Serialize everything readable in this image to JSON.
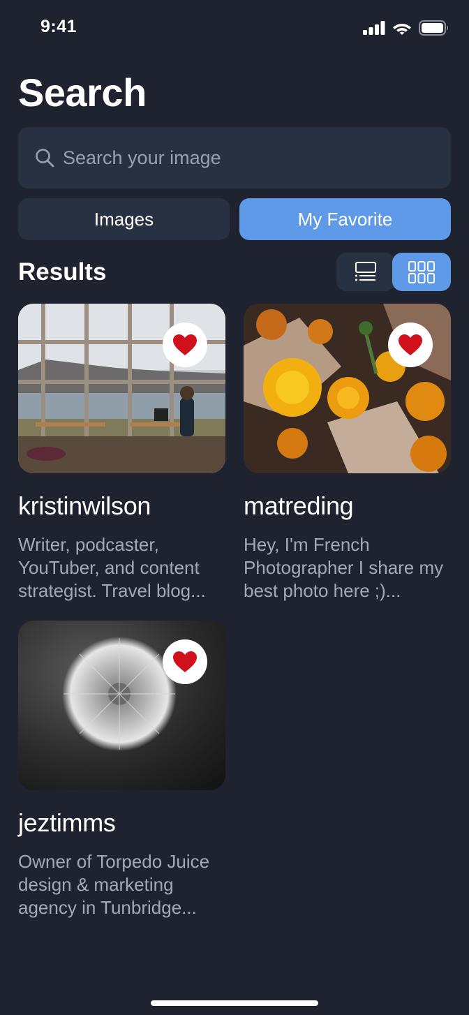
{
  "status_bar": {
    "time": "9:41"
  },
  "header": {
    "title": "Search"
  },
  "search": {
    "placeholder": "Search your image",
    "value": ""
  },
  "tabs": [
    {
      "label": "Images",
      "active": false
    },
    {
      "label": "My Favorite",
      "active": true
    }
  ],
  "results": {
    "title": "Results",
    "view_mode": "grid",
    "items": [
      {
        "username": "kristinwilson",
        "bio": "Writer, podcaster, YouTuber, and content strategist. Travel blog...",
        "favorited": true,
        "image_icon": "office-window-photo"
      },
      {
        "username": "matreding",
        "bio": "Hey,  I'm French Photographer I share my best photo here ;)...",
        "favorited": true,
        "image_icon": "flowers-photo"
      },
      {
        "username": "jeztimms",
        "bio": "Owner of Torpedo Juice design & marketing agency in Tunbridge...",
        "favorited": true,
        "image_icon": "dandelion-photo"
      }
    ]
  },
  "colors": {
    "background": "#1f2330",
    "surface": "#283142",
    "accent": "#5e9ae8",
    "heart": "#d0101b"
  }
}
